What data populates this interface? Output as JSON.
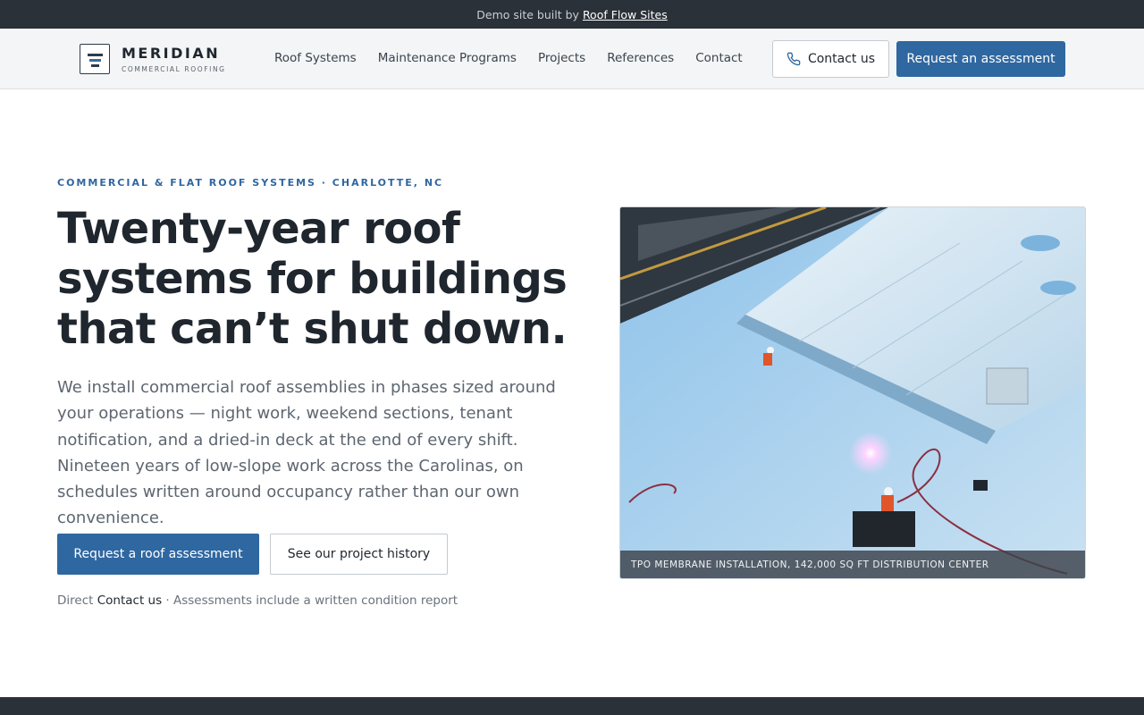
{
  "banner": {
    "text": "Demo site built by",
    "link": "Roof Flow Sites"
  },
  "brand": {
    "name": "MERIDIAN",
    "tagline": "COMMERCIAL ROOFING"
  },
  "nav": {
    "items": [
      {
        "label": "Roof Systems"
      },
      {
        "label": "Maintenance Programs"
      },
      {
        "label": "Projects"
      },
      {
        "label": "References"
      },
      {
        "label": "Contact"
      }
    ],
    "contact_label": "Contact us",
    "assessment_label": "Request an assessment"
  },
  "hero": {
    "eyebrow": "COMMERCIAL & FLAT ROOF SYSTEMS · CHARLOTTE, NC",
    "headline": "Twenty-year roof systems for buildings that can’t shut down.",
    "lede": "We install commercial roof assemblies in phases sized around your operations — night work, weekend sections, tenant notification, and a dried-in deck at the end of every shift. Nineteen years of low-slope work across the Carolinas, on schedules written around occupancy rather than our own convenience.",
    "primary_cta": "Request a roof assessment",
    "secondary_cta": "See our project history",
    "note_prefix": "Direct",
    "note_link": "Contact us",
    "note_suffix": "· Assessments include a written condition report",
    "image_caption": "TPO MEMBRANE INSTALLATION, 142,000 SQ FT DISTRIBUTION CENTER"
  },
  "colors": {
    "accent": "#2f67a0",
    "dark": "#2b3139",
    "text": "#1f262e",
    "muted": "#5d6670"
  }
}
